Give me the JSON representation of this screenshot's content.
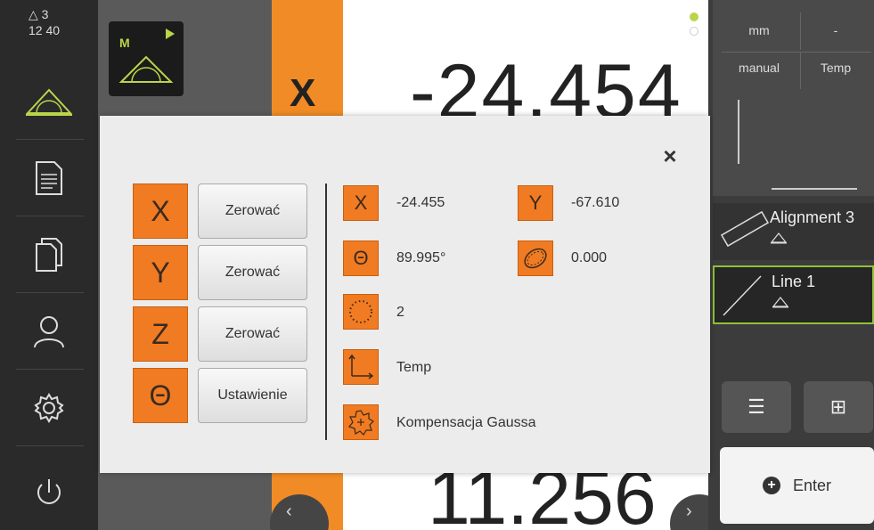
{
  "status": {
    "delta": "△ 3",
    "time": "12 40"
  },
  "axis_label": "X",
  "big_values": {
    "top": "-24.454",
    "bottom": "11.256"
  },
  "units": {
    "length": "mm",
    "angle": "-",
    "mode": "manual",
    "temp": "Temp"
  },
  "features": [
    {
      "label": "Alignment 3"
    },
    {
      "label": "Line 1"
    }
  ],
  "enter_label": "Enter",
  "modal": {
    "close": "×",
    "axes": [
      {
        "axis": "X",
        "button": "Zerować"
      },
      {
        "axis": "Y",
        "button": "Zerować"
      },
      {
        "axis": "Z",
        "button": "Zerować"
      },
      {
        "axis": "Θ",
        "button": "Ustawienie"
      }
    ],
    "info": {
      "x_label": "X",
      "x_value": "-24.455",
      "y_label": "Y",
      "y_value": "-67.610",
      "theta_label": "Θ",
      "theta_value": "89.995°",
      "form_value": "0.000",
      "points_value": "2",
      "coord_system": "Temp",
      "compensation": "Kompensacja Gaussa"
    }
  },
  "colors": {
    "accent": "#f07b22",
    "green": "#8fc23a",
    "sidebar": "#2a2a2a"
  }
}
